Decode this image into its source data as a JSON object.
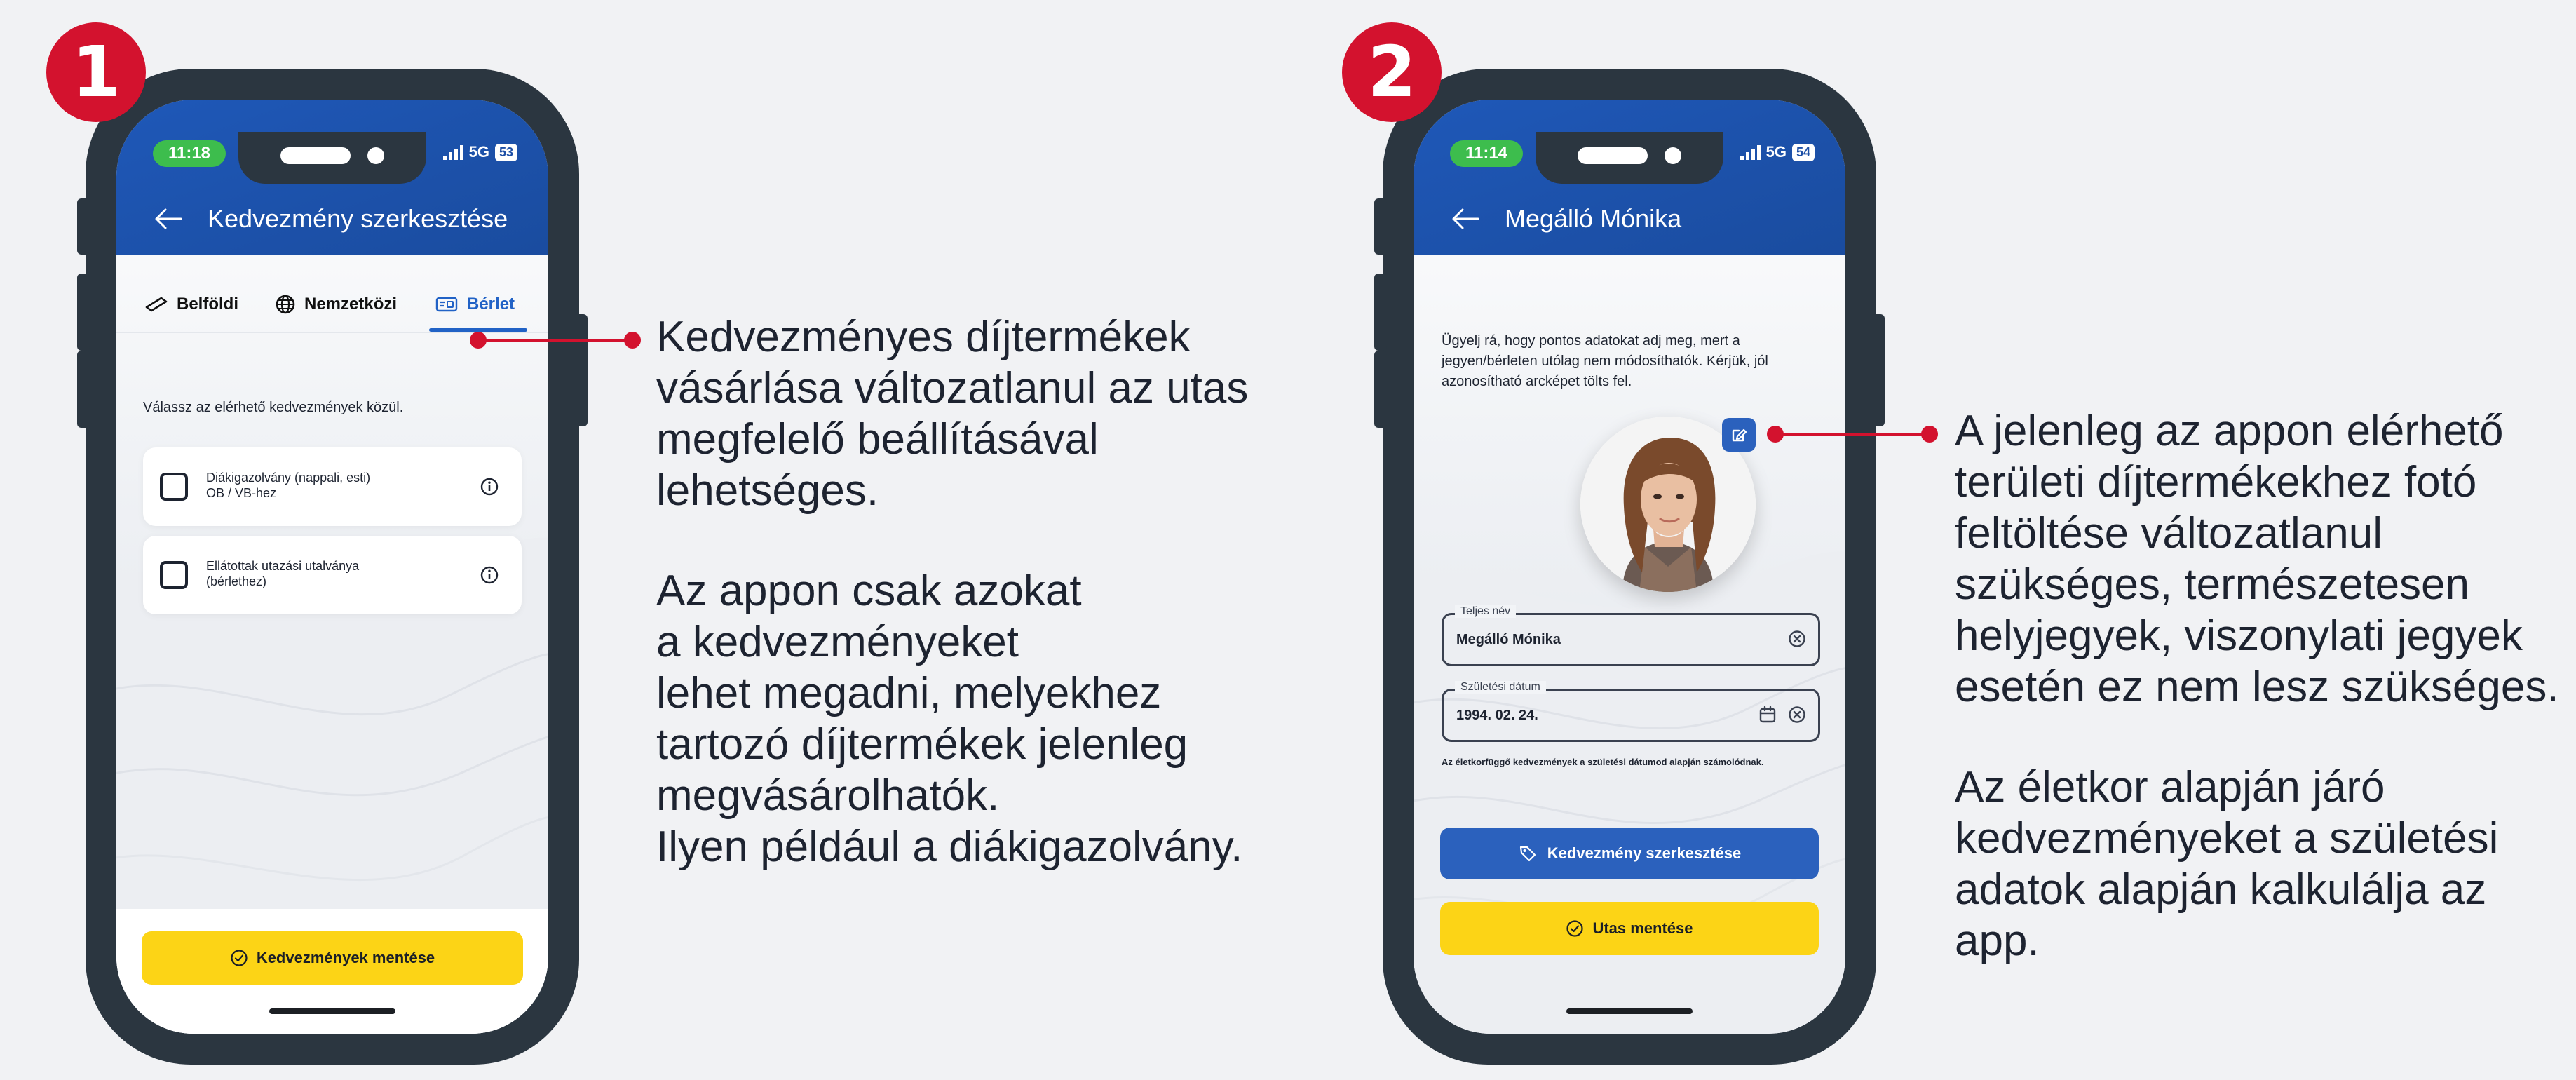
{
  "steps": [
    "1",
    "2"
  ],
  "phone1": {
    "status": {
      "time": "11:18",
      "network": "5G",
      "battery": "53"
    },
    "title": "Kedvezmény szerkesztése",
    "tabs": [
      {
        "label": "Belföldi",
        "icon": "ticket-icon"
      },
      {
        "label": "Nemzetközi",
        "icon": "globe-icon"
      },
      {
        "label": "Bérlet",
        "icon": "pass-card-icon",
        "active": true
      }
    ],
    "prompt": "Válassz az elérhető kedvezmények közül.",
    "options": [
      {
        "line1": "Diákigazolvány (nappali, esti)",
        "line2": "OB / VB-hez",
        "checked": false
      },
      {
        "line1": "Ellátottak utazási utalványa",
        "line2": "(bérlethez)",
        "checked": false
      }
    ],
    "save_button": "Kedvezmények mentése"
  },
  "phone2": {
    "status": {
      "time": "11:14",
      "network": "5G",
      "battery": "54"
    },
    "title": "Megálló Mónika",
    "notice": "Ügyelj rá, hogy pontos adatokat adj meg, mert a jegyen/bérleten utólag nem módosíthatók. Kérjük, jól azonosítható arcképet tölts fel.",
    "name_field": {
      "label": "Teljes név",
      "value": "Megálló Mónika"
    },
    "birth_field": {
      "label": "Születési dátum",
      "value": "1994. 02. 24."
    },
    "helper": "Az életkorfüggő kedvezmények a születési dátumod alapján számolódnak.",
    "edit_discount_button": "Kedvezmény szerkesztése",
    "save_passenger_button": "Utas mentése"
  },
  "callout1": {
    "paragraph1": [
      "Kedvezményes díjtermékek",
      "vásárlása változatlanul az utas",
      "megfelelő beállításával",
      "lehetséges."
    ],
    "paragraph2": [
      "Az appon csak azokat",
      "a kedvezményeket",
      "lehet megadni, melyekhez",
      "tartozó díjtermékek jelenleg",
      "megvásárolhatók.",
      "Ilyen például a diákigazolvány."
    ]
  },
  "callout2": {
    "paragraph1": [
      "A jelenleg az appon elérhető",
      "területi díjtermékekhez fotó",
      "feltöltése változatlanul",
      "szükséges, természetesen",
      "helyjegyek, viszonylati jegyek",
      "esetén ez nem lesz szükséges."
    ],
    "paragraph2": [
      "Az életkor alapján járó",
      "kedvezményeket a születési",
      "adatok alapján kalkulálja az app."
    ]
  },
  "colors": {
    "accent_red": "#d3122e",
    "app_blue": "#1f58b8",
    "button_yellow": "#fcd416",
    "phone_frame": "#2b3640"
  }
}
